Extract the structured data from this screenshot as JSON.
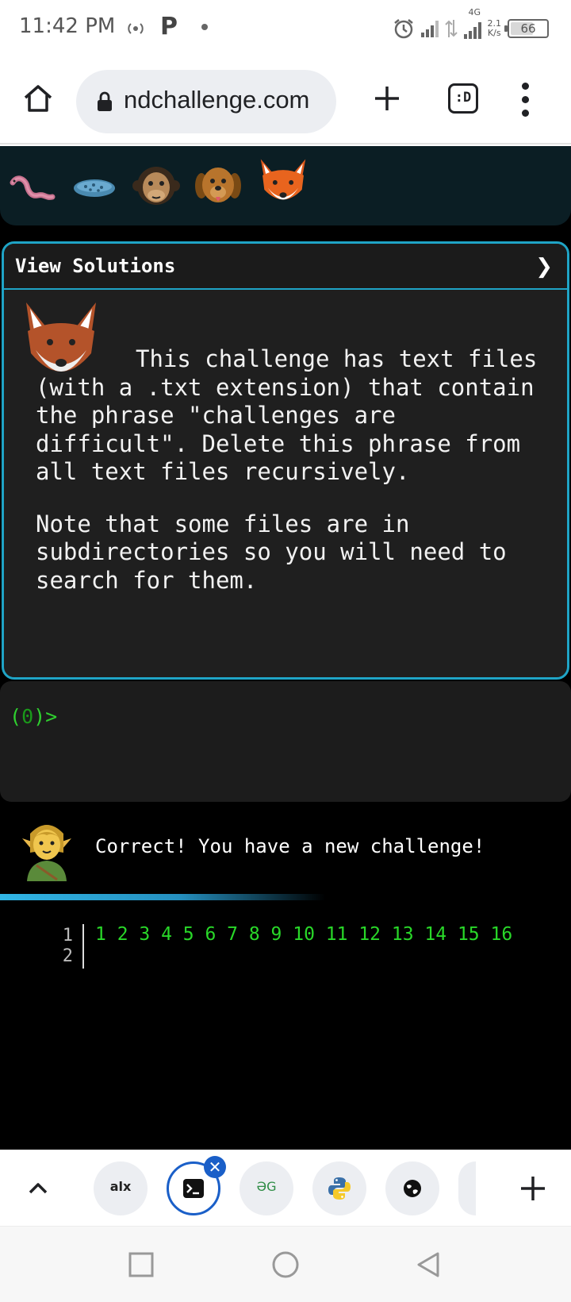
{
  "status_bar": {
    "time": "11:42 PM",
    "carrier_badge": "P",
    "network_label": "4G",
    "net_speed_value": "2.1",
    "net_speed_unit": "K/s",
    "battery_level": "66",
    "icons": [
      "hotspot-icon",
      "alarm-icon",
      "signal-icon",
      "data-arrows-icon",
      "battery-icon"
    ]
  },
  "browser": {
    "url_display": "ndchallenge.com",
    "tab_switcher_label": ":D",
    "icons": [
      "home-icon",
      "lock-icon",
      "new-tab-icon",
      "tab-switcher-icon",
      "more-menu-icon"
    ]
  },
  "levels": {
    "icons": [
      "worm-icon",
      "bacterium-icon",
      "chimpanzee-icon",
      "dog-icon",
      "fox-icon"
    ]
  },
  "challenge": {
    "header": "View Solutions",
    "toggle_glyph": "❯",
    "paragraph_1": "This challenge has text files (with a .txt extension) that contain the phrase \"challenges are difficult\". Delete this phrase from all text files recursively.",
    "paragraph_2": "Note that some files are in subdirectories so you will need to search for them."
  },
  "terminal": {
    "prompt_open": "(",
    "prompt_count": "0",
    "prompt_close": ")>"
  },
  "feedback": {
    "message": "Correct! You have a new challenge!",
    "progress": 0.57
  },
  "editor": {
    "line_numbers": [
      "1",
      "2"
    ],
    "line_1": "1  2  3  4  5  6  7  8  9  10  11  12  13  14  15  16"
  },
  "tab_strip": {
    "tabs": [
      {
        "icon": "alx-favicon",
        "label": "alx"
      },
      {
        "icon": "terminal-favicon",
        "label": ""
      },
      {
        "icon": "geeksforgeeks-favicon",
        "label": "ƏG"
      },
      {
        "icon": "python-favicon",
        "label": ""
      },
      {
        "icon": "globe-favicon",
        "label": ""
      }
    ],
    "close_glyph": "✕"
  },
  "colors": {
    "accent": "#1fa4c6",
    "terminal_green": "#29d829",
    "chrome_blue": "#1a5fc8"
  }
}
